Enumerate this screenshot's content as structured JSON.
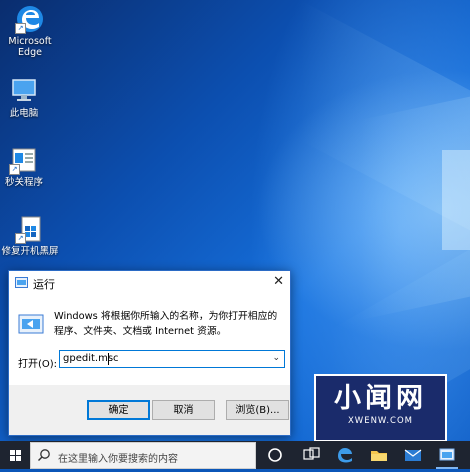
{
  "desktop": {
    "icons": [
      {
        "label": "Microsoft\nEdge",
        "icon": "edge-icon"
      },
      {
        "label": "此电脑",
        "icon": "this-pc-icon"
      },
      {
        "label": "秒关程序",
        "icon": "app-window-icon"
      },
      {
        "label": "修复开机黑屏",
        "icon": "repair-icon"
      }
    ]
  },
  "run_dialog": {
    "title": "运行",
    "description": "Windows 将根据你所输入的名称，为你打开相应的程序、文件夹、文档或 Internet 资源。",
    "open_label": "打开(O):",
    "input_value": "gpedit.msc",
    "buttons": {
      "ok": "确定",
      "cancel": "取消",
      "browse": "浏览(B)..."
    }
  },
  "watermark": {
    "title": "小闻网",
    "subtitle": "XWENW.COM"
  },
  "taskbar": {
    "search_placeholder": "在这里输入你要搜索的内容",
    "icons": [
      "task-view-icon",
      "cortana-icon",
      "edge-icon",
      "file-explorer-icon",
      "mail-icon",
      "run-app-icon"
    ]
  },
  "colors": {
    "accent": "#0078d7",
    "taskbar": "#1e2430",
    "watermark_bg": "#1a2b6b"
  }
}
